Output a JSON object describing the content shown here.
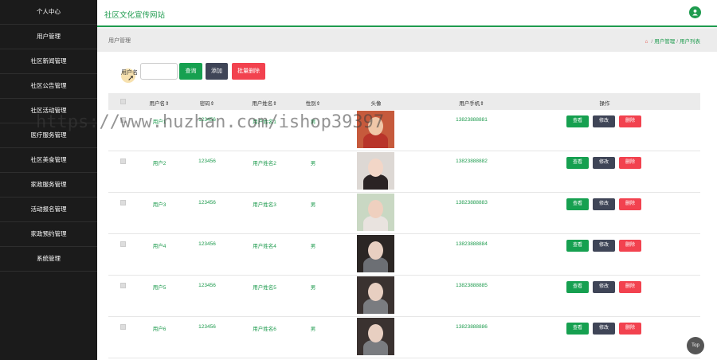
{
  "sidebar": {
    "items": [
      "个人中心",
      "用户管理",
      "社区新闻管理",
      "社区公告管理",
      "社区活动管理",
      "医疗服务管理",
      "社区美食管理",
      "家政服务管理",
      "活动报名管理",
      "家政预约管理",
      "系统管理"
    ]
  },
  "header": {
    "site_title": "社区文化宣传网站",
    "user_icon": "user-icon"
  },
  "crumbbar": {
    "title": "用户管理",
    "crumbs": [
      "用户管理",
      "用户列表"
    ],
    "home_icon": "home-icon"
  },
  "search": {
    "label": "用户名",
    "value": "",
    "query_label": "查询",
    "add_label": "添加",
    "batch_delete_label": "批量删除"
  },
  "table": {
    "headers": [
      "用户名",
      "密码",
      "用户姓名",
      "性别",
      "头像",
      "用户手机",
      "操作"
    ],
    "actions": {
      "view": "查看",
      "edit": "修改",
      "delete": "删除"
    },
    "rows": [
      {
        "username": "用户1",
        "password": "123456",
        "name": "用户姓名1",
        "gender": "男",
        "phone": "13823888881"
      },
      {
        "username": "用户2",
        "password": "123456",
        "name": "用户姓名2",
        "gender": "男",
        "phone": "13823888882"
      },
      {
        "username": "用户3",
        "password": "123456",
        "name": "用户姓名3",
        "gender": "男",
        "phone": "13823888883"
      },
      {
        "username": "用户4",
        "password": "123456",
        "name": "用户姓名4",
        "gender": "男",
        "phone": "13823888884"
      },
      {
        "username": "用户5",
        "password": "123456",
        "name": "用户姓名5",
        "gender": "男",
        "phone": "13823888885"
      },
      {
        "username": "用户6",
        "password": "123456",
        "name": "用户姓名6",
        "gender": "男",
        "phone": "13823888886"
      }
    ]
  },
  "watermark": "https://www.huzhan.com/ishop39397",
  "top_button": "Top",
  "colors": {
    "accent": "#1e9b4e",
    "dark_button": "#3f4557",
    "danger": "#f2424f",
    "sidebar": "#1b1b1b"
  }
}
